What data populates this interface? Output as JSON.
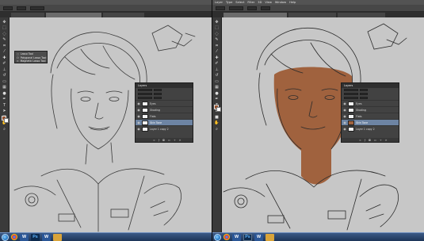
{
  "colors": {
    "menubar": "#535353",
    "canvas": "#c7c7c7",
    "skin_fill": "#a0623e",
    "selected_layer": "#6d84a3",
    "taskbar": "#1d3558"
  },
  "menus": [
    "Layer",
    "Type",
    "Select",
    "Filter",
    "3D",
    "View",
    "Window",
    "Help"
  ],
  "options": {
    "left": [],
    "right": []
  },
  "tool_flyout": {
    "items": [
      {
        "icon": "lasso-icon",
        "label": "Lasso Tool"
      },
      {
        "icon": "polygonal-lasso-icon",
        "label": "Polygonal Lasso Tool"
      },
      {
        "icon": "magnetic-lasso-icon",
        "label": "Magnetic Lasso Tool"
      }
    ]
  },
  "layers_panel": {
    "tab_label": "Layers",
    "layers": [
      {
        "name": "Eyes"
      },
      {
        "name": "Shading"
      },
      {
        "name": "Flats"
      },
      {
        "name": "Skin Tone"
      },
      {
        "name": "Layer 1 copy 2"
      }
    ]
  },
  "taskbar": {
    "apps": [
      {
        "icon": "chrome-icon",
        "label": ""
      },
      {
        "icon": "word-icon",
        "label": "W"
      },
      {
        "icon": "photoshop-icon",
        "label": "Ps"
      },
      {
        "icon": "word-icon",
        "label": "W"
      },
      {
        "icon": "windows-explorer-icon",
        "label": ""
      }
    ]
  }
}
